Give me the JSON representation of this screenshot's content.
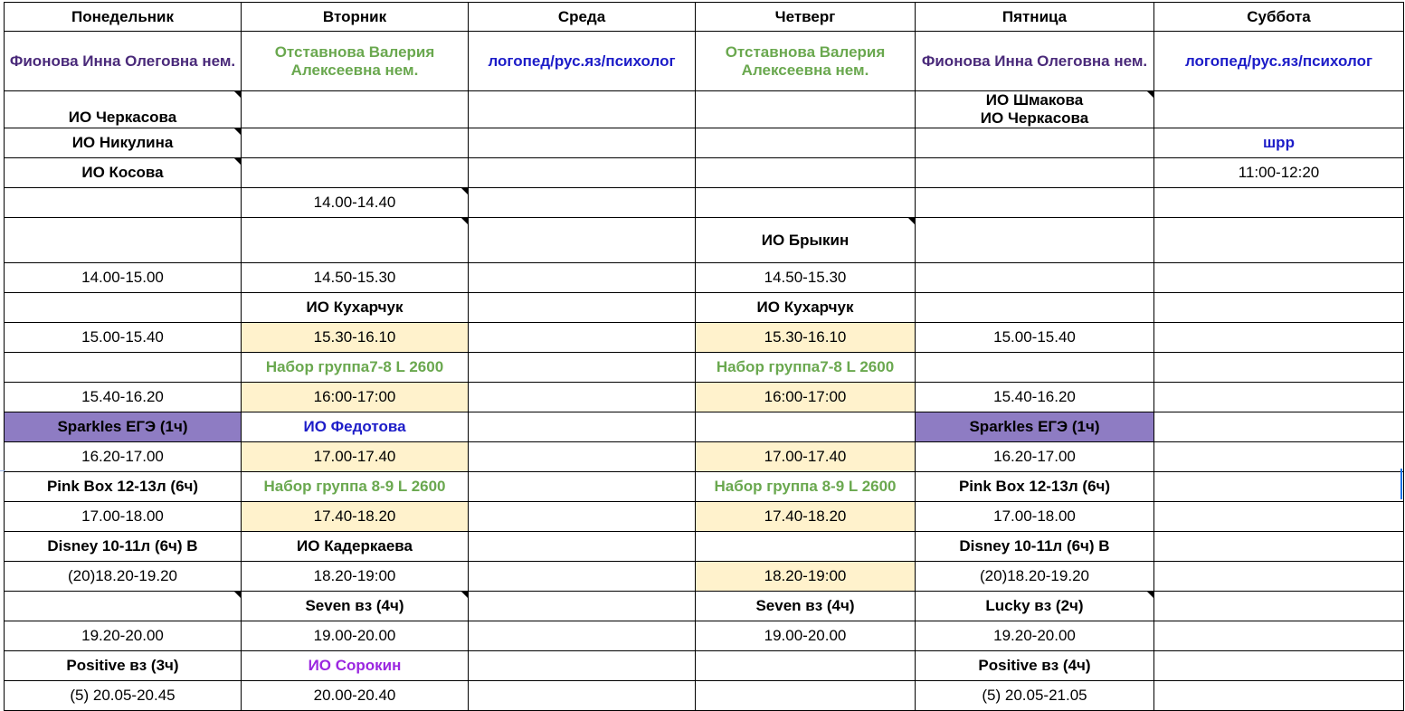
{
  "columns": [
    {
      "day": "Понедельник",
      "teacher": "Фионова Инна Олеговна нем."
    },
    {
      "day": "Вторник",
      "teacher": "Отставнова Валерия Алексеевна нем."
    },
    {
      "day": "Среда",
      "teacher": "логопед/рус.яз/психолог"
    },
    {
      "day": "Четверг",
      "teacher": "Отставнова Валерия Алексеевна нем."
    },
    {
      "day": "Пятница",
      "teacher": "Фионова Инна Олеговна нем."
    },
    {
      "day": "Суббота",
      "teacher": "логопед/рус.яз/психолог"
    }
  ],
  "rows": [
    [
      "ИО Черкасова",
      "",
      "",
      "",
      "ИО Шмакова / ИО Черкасова",
      ""
    ],
    [
      "ИО Никулина",
      "",
      "",
      "",
      "",
      "шрр"
    ],
    [
      "ИО Косова",
      "",
      "",
      "",
      "",
      "11:00-12:20"
    ],
    [
      "",
      "14.00-14.40",
      "",
      "",
      "",
      ""
    ],
    [
      "",
      "",
      "",
      "ИО Брыкин",
      "",
      ""
    ],
    [
      "14.00-15.00",
      "14.50-15.30",
      "",
      "14.50-15.30",
      "",
      ""
    ],
    [
      "",
      "ИО Кухарчук",
      "",
      "ИО Кухарчук",
      "",
      ""
    ],
    [
      "15.00-15.40",
      "15.30-16.10",
      "",
      "15.30-16.10",
      "15.00-15.40",
      ""
    ],
    [
      "",
      "Набор группа7-8 L 2600",
      "",
      "Набор группа7-8 L 2600",
      "",
      ""
    ],
    [
      "15.40-16.20",
      "16:00-17:00",
      "",
      "16:00-17:00",
      "15.40-16.20",
      ""
    ],
    [
      "Sparkles ЕГЭ (1ч)",
      "ИО Федотова",
      "",
      "",
      "Sparkles ЕГЭ (1ч)",
      ""
    ],
    [
      "16.20-17.00",
      "17.00-17.40",
      "",
      "17.00-17.40",
      "16.20-17.00",
      ""
    ],
    [
      "Pink Box 12-13л (6ч)",
      "Набор группа 8-9 L 2600",
      "",
      "Набор группа 8-9 L 2600",
      "Pink Box 12-13л (6ч)",
      ""
    ],
    [
      "17.00-18.00",
      "17.40-18.20",
      "",
      "17.40-18.20",
      "17.00-18.00",
      ""
    ],
    [
      "Disney 10-11л (6ч) В",
      "ИО Кадеркаева",
      "",
      "",
      "Disney 10-11л (6ч) В",
      ""
    ],
    [
      "(20)18.20-19.20",
      "18.20-19:00",
      "",
      "18.20-19:00",
      "(20)18.20-19.20",
      ""
    ],
    [
      "",
      "Seven вз (4ч)",
      "",
      "Seven вз (4ч)",
      "Lucky вз (2ч)",
      ""
    ],
    [
      "19.20-20.00",
      "19.00-20.00",
      "",
      "19.00-20.00",
      "19.20-20.00",
      ""
    ],
    [
      "Positive вз (3ч)",
      "ИО Сорокин",
      "",
      "",
      "Positive вз (4ч)",
      ""
    ],
    [
      "(5) 20.05-20.45",
      "20.00-20.40",
      "",
      "",
      "(5) 20.05-21.05",
      ""
    ]
  ],
  "colors": {
    "teacher_purple": "#4a2a7a",
    "green": "#6aa84f",
    "blue": "#1c1cc8",
    "violet": "#9b27e0",
    "cream_fill": "#fff2cc",
    "lavender_fill": "#8e7cc3"
  }
}
